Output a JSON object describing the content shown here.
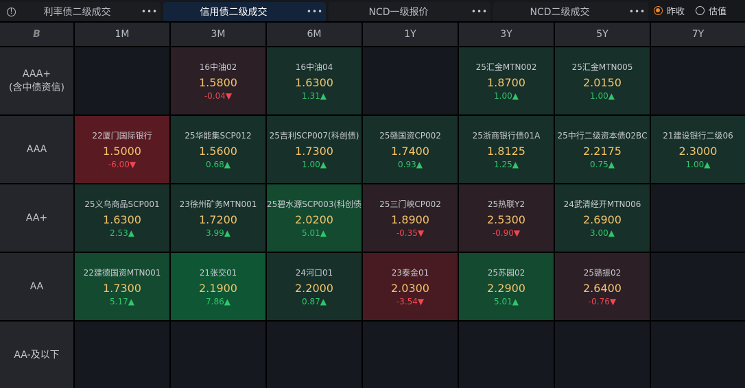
{
  "tabs": [
    {
      "label": "利率债二级成交",
      "active": false,
      "more": "•••"
    },
    {
      "label": "信用债二级成交",
      "active": true,
      "more": "•••"
    },
    {
      "label": "NCD一级报价",
      "active": false,
      "more": "•••"
    },
    {
      "label": "NCD二级成交",
      "active": false,
      "more": "•••"
    }
  ],
  "radio": [
    {
      "label": "昨收",
      "checked": true
    },
    {
      "label": "估值",
      "checked": false
    }
  ],
  "corner_icon": "B",
  "columns": [
    "1M",
    "3M",
    "6M",
    "1Y",
    "3Y",
    "5Y",
    "7Y"
  ],
  "colors": {
    "empty": "#15191f",
    "green_pale": "#17302a",
    "green_mid": "#134a30",
    "green_bright": "#0e5634",
    "red_pale": "#2c1f26",
    "red_mid": "#481b22",
    "red_strong": "#5a1a22"
  },
  "rows": [
    {
      "label": "AAA+\n(含中债资信)",
      "cells": [
        null,
        {
          "name": "16中油02",
          "price": "1.5800",
          "change": "-0.04",
          "dir": "down",
          "tone": "red_pale"
        },
        {
          "name": "16中油04",
          "price": "1.6300",
          "change": "1.31",
          "dir": "up",
          "tone": "green_pale"
        },
        null,
        {
          "name": "25汇金MTN002",
          "price": "1.8700",
          "change": "1.00",
          "dir": "up",
          "tone": "green_pale"
        },
        {
          "name": "25汇金MTN005",
          "price": "2.0150",
          "change": "1.00",
          "dir": "up",
          "tone": "green_pale"
        },
        null
      ]
    },
    {
      "label": "AAA",
      "cells": [
        {
          "name": "22厦门国际银行",
          "price": "1.5000",
          "change": "-6.00",
          "dir": "down",
          "tone": "red_strong"
        },
        {
          "name": "25华能集SCP012",
          "price": "1.5600",
          "change": "0.68",
          "dir": "up",
          "tone": "green_pale"
        },
        {
          "name": "25吉利SCP007(科创债)",
          "price": "1.7300",
          "change": "1.00",
          "dir": "up",
          "tone": "green_pale"
        },
        {
          "name": "25赣国资CP002",
          "price": "1.7400",
          "change": "0.93",
          "dir": "up",
          "tone": "green_pale"
        },
        {
          "name": "25浙商银行债01A",
          "price": "1.8125",
          "change": "1.25",
          "dir": "up",
          "tone": "green_pale"
        },
        {
          "name": "25中行二级资本债02BC",
          "price": "2.2175",
          "change": "0.75",
          "dir": "up",
          "tone": "green_pale"
        },
        {
          "name": "21建设银行二级06",
          "price": "2.3000",
          "change": "1.00",
          "dir": "up",
          "tone": "green_pale"
        }
      ]
    },
    {
      "label": "AA+",
      "cells": [
        {
          "name": "25义乌商品SCP001",
          "price": "1.6300",
          "change": "2.53",
          "dir": "up",
          "tone": "green_pale"
        },
        {
          "name": "23徐州矿务MTN001",
          "price": "1.7200",
          "change": "3.99",
          "dir": "up",
          "tone": "green_pale"
        },
        {
          "name": "25碧水源SCP003(科创债",
          "price": "2.0200",
          "change": "5.01",
          "dir": "up",
          "tone": "green_mid"
        },
        {
          "name": "25三门峡CP002",
          "price": "1.8900",
          "change": "-0.35",
          "dir": "down",
          "tone": "red_pale"
        },
        {
          "name": "25热联Y2",
          "price": "2.5300",
          "change": "-0.90",
          "dir": "down",
          "tone": "red_pale"
        },
        {
          "name": "24武清经开MTN006",
          "price": "2.6900",
          "change": "3.00",
          "dir": "up",
          "tone": "green_pale"
        },
        null
      ]
    },
    {
      "label": "AA",
      "cells": [
        {
          "name": "22建德国资MTN001",
          "price": "1.7300",
          "change": "5.17",
          "dir": "up",
          "tone": "green_mid"
        },
        {
          "name": "21张交01",
          "price": "2.1900",
          "change": "7.86",
          "dir": "up",
          "tone": "green_bright"
        },
        {
          "name": "24河口01",
          "price": "2.2000",
          "change": "0.87",
          "dir": "up",
          "tone": "green_pale"
        },
        {
          "name": "23泰金01",
          "price": "2.0300",
          "change": "-3.54",
          "dir": "down",
          "tone": "red_mid"
        },
        {
          "name": "25苏园02",
          "price": "2.2900",
          "change": "5.01",
          "dir": "up",
          "tone": "green_mid"
        },
        {
          "name": "25赣振02",
          "price": "2.6400",
          "change": "-0.76",
          "dir": "down",
          "tone": "red_pale"
        },
        null
      ]
    },
    {
      "label": "AA-及以下",
      "cells": [
        null,
        null,
        null,
        null,
        null,
        null,
        null
      ]
    }
  ]
}
